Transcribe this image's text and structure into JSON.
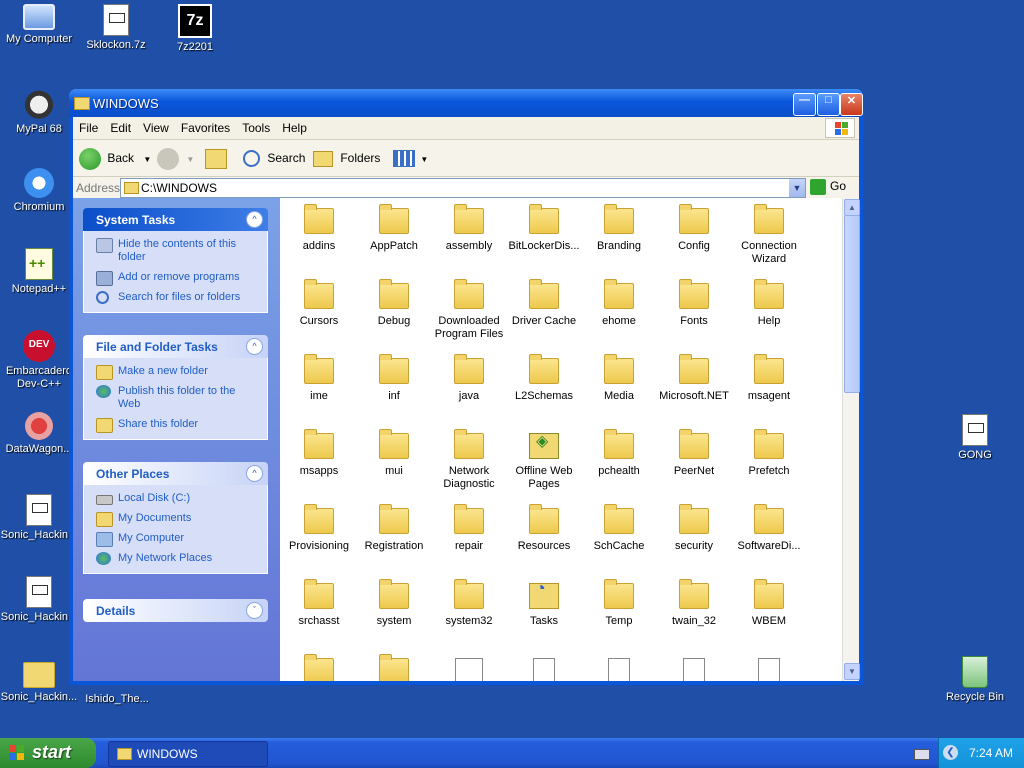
{
  "desktop": {
    "icons": [
      {
        "label": "My Computer"
      },
      {
        "label": "Sklockon.7z"
      },
      {
        "label": "7z2201"
      },
      {
        "label": "MyPal 68"
      },
      {
        "label": "Chromium"
      },
      {
        "label": "Notepad++"
      },
      {
        "label": "Embarcadero Dev-C++"
      },
      {
        "label": "DataWagon..."
      },
      {
        "label": "Sonic_Hackin..."
      },
      {
        "label": "Sonic_Hackin..."
      },
      {
        "label": "Sonic_Hackin..."
      },
      {
        "label": "Ishido_The..."
      },
      {
        "label": "GONG"
      },
      {
        "label": "Recycle Bin"
      }
    ],
    "icon_glyphs": {
      "seven_zip": "7z",
      "devcpp": "DEV"
    }
  },
  "window": {
    "title": "WINDOWS",
    "menu": [
      "File",
      "Edit",
      "View",
      "Favorites",
      "Tools",
      "Help"
    ],
    "toolbar": {
      "back": "Back",
      "search": "Search",
      "folders": "Folders"
    },
    "address": {
      "label": "Address",
      "value": "C:\\WINDOWS",
      "go": "Go"
    },
    "taskpane": {
      "system_tasks": {
        "title": "System Tasks",
        "links": [
          "Hide the contents of this folder",
          "Add or remove programs",
          "Search for files or folders"
        ]
      },
      "file_folder_tasks": {
        "title": "File and Folder Tasks",
        "links": [
          "Make a new folder",
          "Publish this folder to the Web",
          "Share this folder"
        ]
      },
      "other_places": {
        "title": "Other Places",
        "links": [
          "Local Disk (C:)",
          "My Documents",
          "My Computer",
          "My Network Places"
        ]
      },
      "details": {
        "title": "Details"
      }
    },
    "files": [
      "addins",
      "AppPatch",
      "assembly",
      "BitLockerDis...",
      "Branding",
      "Config",
      "Connection Wizard",
      "Cursors",
      "Debug",
      "Downloaded Program Files",
      "Driver Cache",
      "ehome",
      "Fonts",
      "Help",
      "ime",
      "inf",
      "java",
      "L2Schemas",
      "Media",
      "Microsoft.NET",
      "msagent",
      "msapps",
      "mui",
      "Network Diagnostic",
      "Offline Web Pages",
      "pchealth",
      "PeerNet",
      "Prefetch",
      "Provisioning",
      "Registration",
      "repair",
      "Resources",
      "SchCache",
      "security",
      "SoftwareDi...",
      "srchasst",
      "system",
      "system32",
      "Tasks",
      "Temp",
      "twain_32",
      "WBEM"
    ]
  },
  "taskbar": {
    "start": "start",
    "task": "WINDOWS",
    "clock": "7:24 AM"
  }
}
